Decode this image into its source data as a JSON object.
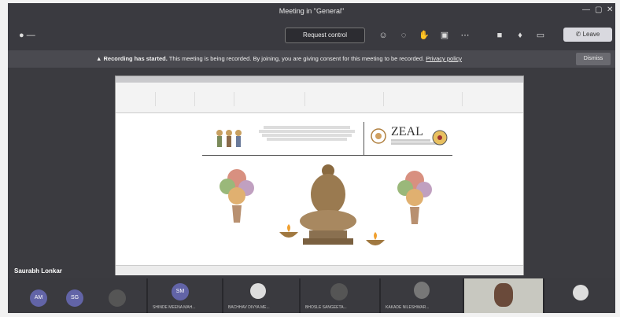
{
  "window": {
    "title": "Meeting in \"General\"",
    "controls": [
      "—",
      "▢",
      "✕"
    ]
  },
  "toolbar": {
    "request_control_label": "Request control",
    "leave_label": "Leave",
    "icons": [
      "people-icon",
      "chat-icon",
      "raise-hand-icon",
      "rooms-icon",
      "more-icon",
      "camera-icon",
      "mic-icon",
      "share-icon"
    ]
  },
  "banner": {
    "bold_text": "Recording has started.",
    "text": " This meeting is being recorded. By joining, you are giving consent for this meeting to be recorded.",
    "link": "Privacy policy",
    "dismiss_label": "Dismiss"
  },
  "shared_content": {
    "zeal_logo": "ZEAL"
  },
  "stage": {
    "speaker_name": "Saurabh Lonkar"
  },
  "participants": [
    {
      "initials": "AM",
      "name": ""
    },
    {
      "initials": "SG",
      "name": ""
    },
    {
      "initials": "",
      "name": ""
    },
    {
      "initials": "SM",
      "name": "SHINDE MEENA MAH..."
    },
    {
      "initials": "",
      "name": "BACHHAV DIVYA ME..."
    },
    {
      "initials": "",
      "name": "BHOSLE SANGEETA..."
    },
    {
      "initials": "",
      "name": "KAKADE NILESHWAR..."
    },
    {
      "initials": "",
      "name": ""
    },
    {
      "initials": "",
      "name": ""
    }
  ],
  "colors": {
    "teams_purple": "#6264a7",
    "frame_bg": "#2b2b2f"
  }
}
